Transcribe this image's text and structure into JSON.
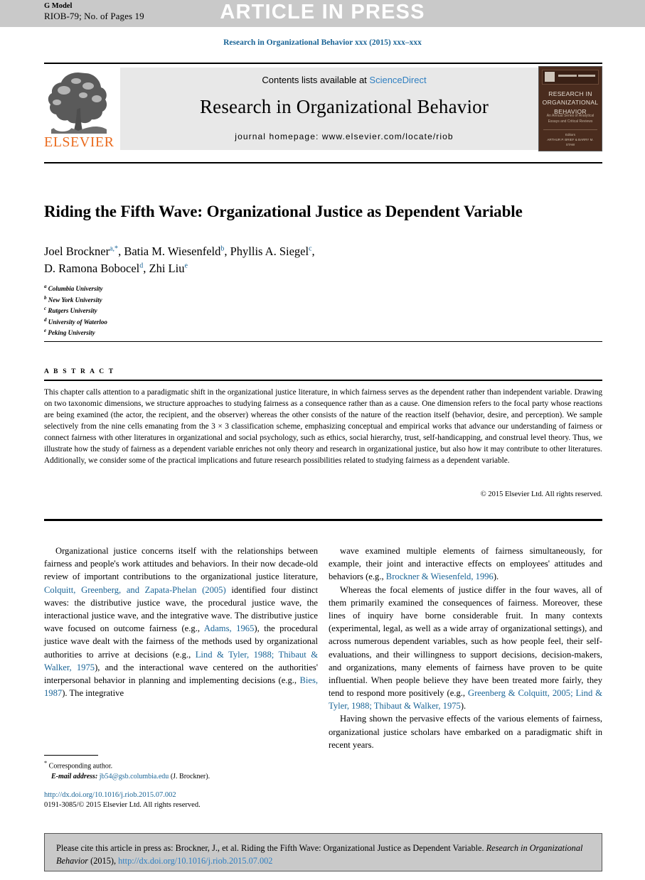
{
  "banner": {
    "g_model": "G Model",
    "article_id": "RIOB-79; No. of Pages 19",
    "article_in_press": "ARTICLE IN PRESS"
  },
  "running_head": "Research in Organizational Behavior xxx (2015) xxx–xxx",
  "masthead": {
    "contents_prefix": "Contents lists available at ",
    "sciencedirect": "ScienceDirect",
    "journal_name": "Research in Organizational Behavior",
    "homepage": "journal homepage: www.elsevier.com/locate/riob",
    "publisher": "ELSEVIER",
    "cover": {
      "title_line1": "RESEARCH IN",
      "title_line2": "ORGANIZATIONAL",
      "title_line3": "BEHAVIOR",
      "subtitle": "An Annual Series of Analytical Essays and Critical Reviews",
      "editors_label": "Editors",
      "editors": "ARTHUR P. BRIEF & BARRY M. STAW"
    }
  },
  "article": {
    "title": "Riding the Fifth Wave: Organizational Justice as Dependent Variable",
    "authors": [
      {
        "name": "Joel Brockner",
        "marks": "a,*"
      },
      {
        "name": "Batia M. Wiesenfeld",
        "marks": "b"
      },
      {
        "name": "Phyllis A. Siegel",
        "marks": "c"
      },
      {
        "name": "D. Ramona Bobocel",
        "marks": "d"
      },
      {
        "name": "Zhi Liu",
        "marks": "e"
      }
    ],
    "affiliations": [
      {
        "mark": "a",
        "name": "Columbia University"
      },
      {
        "mark": "b",
        "name": "New York University"
      },
      {
        "mark": "c",
        "name": "Rutgers University"
      },
      {
        "mark": "d",
        "name": "University of Waterloo"
      },
      {
        "mark": "e",
        "name": "Peking University"
      }
    ]
  },
  "abstract": {
    "heading": "A B S T R A C T",
    "text": "This chapter calls attention to a paradigmatic shift in the organizational justice literature, in which fairness serves as the dependent rather than independent variable. Drawing on two taxonomic dimensions, we structure approaches to studying fairness as a consequence rather than as a cause. One dimension refers to the focal party whose reactions are being examined (the actor, the recipient, and the observer) whereas the other consists of the nature of the reaction itself (behavior, desire, and perception). We sample selectively from the nine cells emanating from the 3 × 3 classification scheme, emphasizing conceptual and empirical works that advance our understanding of fairness or connect fairness with other literatures in organizational and social psychology, such as ethics, social hierarchy, trust, self-handicapping, and construal level theory. Thus, we illustrate how the study of fairness as a dependent variable enriches not only theory and research in organizational justice, but also how it may contribute to other literatures. Additionally, we consider some of the practical implications and future research possibilities related to studying fairness as a dependent variable.",
    "copyright": "© 2015 Elsevier Ltd. All rights reserved."
  },
  "body": {
    "left_column": [
      {
        "segments": [
          {
            "t": "Organizational justice concerns itself with the relationships between fairness and people's work attitudes and behaviors. In their now decade-old review of important contributions to the organizational justice literature, ",
            "ref": false
          },
          {
            "t": "Colquitt, Greenberg, and Zapata-Phelan (2005)",
            "ref": true
          },
          {
            "t": " identified four distinct waves: the distributive justice wave, the procedural justice wave, the interactional justice wave, and the integrative wave. The distributive justice wave focused on outcome fairness (e.g., ",
            "ref": false
          },
          {
            "t": "Adams, 1965",
            "ref": true
          },
          {
            "t": "), the procedural justice wave dealt with the fairness of the methods used by organizational authorities to arrive at decisions (e.g., ",
            "ref": false
          },
          {
            "t": "Lind & Tyler, 1988; Thibaut & Walker, 1975",
            "ref": true
          },
          {
            "t": "), and the interactional wave centered on the authorities' interpersonal behavior in planning and implementing decisions (e.g., ",
            "ref": false
          },
          {
            "t": "Bies, 1987",
            "ref": true
          },
          {
            "t": "). The integrative",
            "ref": false
          }
        ]
      }
    ],
    "right_column": [
      {
        "segments": [
          {
            "t": "wave examined multiple elements of fairness simultaneously, for example, their joint and interactive effects on employees' attitudes and behaviors (e.g., ",
            "ref": false
          },
          {
            "t": "Brockner & Wiesenfeld, 1996",
            "ref": true
          },
          {
            "t": ").",
            "ref": false
          }
        ]
      },
      {
        "segments": [
          {
            "t": "Whereas the focal elements of justice differ in the four waves, all of them primarily examined the consequences of fairness. Moreover, these lines of inquiry have borne considerable fruit. In many contexts (experimental, legal, as well as a wide array of organizational settings), and across numerous dependent variables, such as how people feel, their self-evaluations, and their willingness to support decisions, decision-makers, and organizations, many elements of fairness have proven to be quite influential. When people believe they have been treated more fairly, they tend to respond more positively (e.g., ",
            "ref": false
          },
          {
            "t": "Greenberg & Colquitt, 2005; Lind & Tyler, 1988; Thibaut & Walker, 1975",
            "ref": true
          },
          {
            "t": ").",
            "ref": false
          }
        ]
      },
      {
        "segments": [
          {
            "t": "Having shown the pervasive effects of the various elements of fairness, organizational justice scholars have embarked on a paradigmatic shift in recent years.",
            "ref": false
          }
        ]
      }
    ]
  },
  "footnote": {
    "marker": "*",
    "corresponding": "Corresponding author.",
    "email_label": "E-mail address:",
    "email": "jb54@gsb.columbia.edu",
    "email_owner": "(J. Brockner)."
  },
  "publication_info": {
    "doi_url": "http://dx.doi.org/10.1016/j.riob.2015.07.002",
    "issn_line": "0191-3085/© 2015 Elsevier Ltd. All rights reserved."
  },
  "citation_box": {
    "line1": "Please cite this article in press as: Brockner, J., et al. Riding the Fifth Wave: Organizational Justice as Dependent Variable.",
    "journal_italic": "Research in Organizational Behavior",
    "year": "(2015),",
    "doi": "http://dx.doi.org/10.1016/j.riob.2015.07.002"
  },
  "colors": {
    "link_blue": "#1a6496",
    "sciencedirect_blue": "#2f7fc1",
    "elsevier_orange": "#ea6b1e",
    "banner_gray": "#c9c9c9",
    "masthead_gray": "#e8e8e8",
    "cover_brown": "#4a2c1e"
  }
}
